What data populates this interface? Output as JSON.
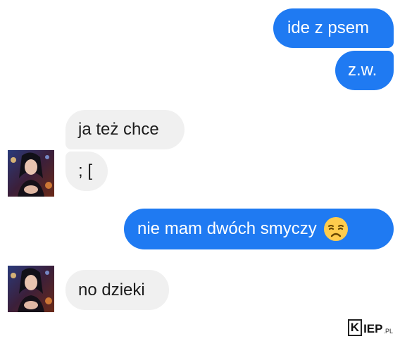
{
  "messages": {
    "m1": "ide z psem",
    "m2": "z.w.",
    "m3": "ja też chce",
    "m4": "; [",
    "m5": "nie mam dwóch smyczy",
    "m6": "no dzieki"
  },
  "emoji_icon": "disappointed-face-icon",
  "colors": {
    "outgoing_bubble": "#1f7af2",
    "incoming_bubble": "#f0f0f0"
  },
  "watermark": {
    "k": "K",
    "rest": "IEP",
    "tld": ".PL"
  }
}
